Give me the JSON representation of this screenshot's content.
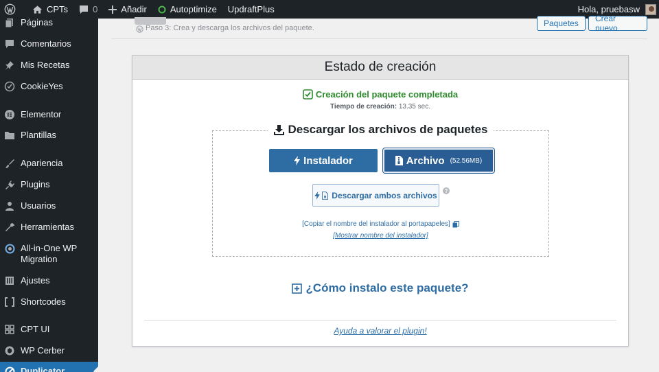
{
  "adminbar": {
    "site": "CPTs",
    "comments_count": "0",
    "add_new": "Añadir",
    "autoptimize": "Autoptimize",
    "updraft": "UpdraftPlus",
    "greeting": "Hola, pruebasw"
  },
  "sidebar": {
    "items": [
      {
        "label": "Páginas",
        "icon": "pages-icon"
      },
      {
        "label": "Comentarios",
        "icon": "comments-icon"
      },
      {
        "label": "Mis Recetas",
        "icon": "pin-icon"
      },
      {
        "label": "CookieYes",
        "icon": "cookie-icon"
      },
      {
        "label": "Elementor",
        "icon": "elementor-icon"
      },
      {
        "label": "Plantillas",
        "icon": "folder-icon"
      },
      {
        "label": "Apariencia",
        "icon": "brush-icon"
      },
      {
        "label": "Plugins",
        "icon": "plugin-icon"
      },
      {
        "label": "Usuarios",
        "icon": "user-icon"
      },
      {
        "label": "Herramientas",
        "icon": "wrench-icon"
      },
      {
        "label": "All-in-One WP Migration",
        "icon": "migration-icon"
      },
      {
        "label": "Ajustes",
        "icon": "settings-icon"
      },
      {
        "label": "Shortcodes",
        "icon": "brackets-icon"
      },
      {
        "label": "CPT UI",
        "icon": "grid-icon"
      },
      {
        "label": "WP Cerber",
        "icon": "shield-icon"
      },
      {
        "label": "Duplicator",
        "icon": "duplicator-icon"
      }
    ]
  },
  "header": {
    "step": "Paso 3: Crea y descarga los archivos del paquete.",
    "packages_button": "Paquetes",
    "create_button": "Crear nuevo"
  },
  "panel": {
    "title": "Estado de creación",
    "complete": "Creación del paquete completada",
    "time_label": "Tiempo de creación:",
    "time_value": "13.35 sec.",
    "download_title": "Descargar los archivos de paquetes",
    "installer_button": "Instalador",
    "archive_button": "Archivo",
    "archive_size": "(52.56MB)",
    "both_button": "Descargar ambos archivos",
    "copy_link": "[Copiar el nombre del instalador al portapapeles]",
    "show_link": "[Mostrar nombre del instalador]",
    "howto": "¿Cómo instalo este paquete?",
    "rate": "Ayuda a valorar el plugin!"
  },
  "colors": {
    "sidebar_bg": "#1d2327",
    "accent": "#2271b1",
    "button": "#2e6da4",
    "success": "#2e8b2e"
  }
}
